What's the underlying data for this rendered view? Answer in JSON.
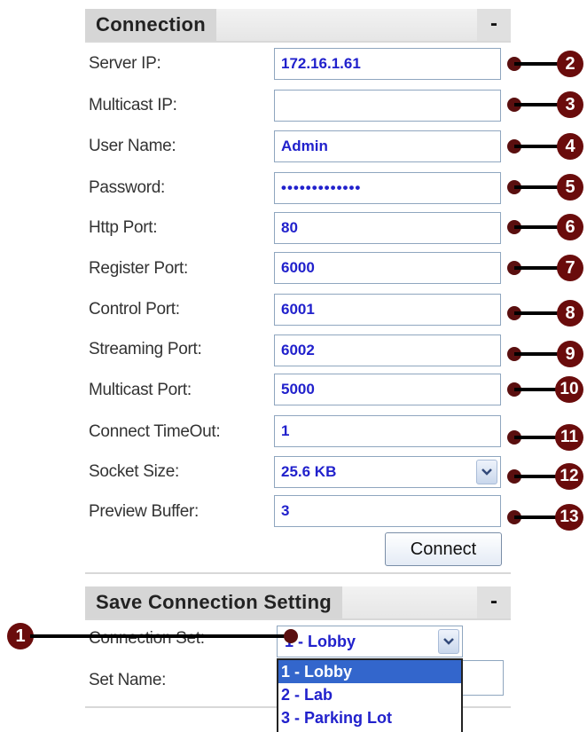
{
  "connection": {
    "header": "Connection",
    "collapse_label": "-",
    "fields": [
      {
        "label": "Server IP:",
        "value": "172.16.1.61",
        "callout": "2"
      },
      {
        "label": "Multicast IP:",
        "value": "",
        "callout": "3"
      },
      {
        "label": "User Name:",
        "value": "Admin",
        "callout": "4"
      },
      {
        "label": "Password:",
        "value": "•••••••••••••",
        "callout": "5"
      },
      {
        "label": "Http Port:",
        "value": "80",
        "callout": "6"
      },
      {
        "label": "Register Port:",
        "value": "6000",
        "callout": "7"
      },
      {
        "label": "Control Port:",
        "value": "6001",
        "callout": "8"
      },
      {
        "label": "Streaming Port:",
        "value": "6002",
        "callout": "9"
      },
      {
        "label": "Multicast Port:",
        "value": "5000",
        "callout": "10"
      },
      {
        "label": "Connect TimeOut:",
        "value": "1",
        "callout": "11"
      },
      {
        "label": "Socket Size:",
        "value": "25.6 KB",
        "callout": "12"
      },
      {
        "label": "Preview Buffer:",
        "value": "3",
        "callout": "13"
      }
    ],
    "connect_button": "Connect"
  },
  "save_setting": {
    "header": "Save Connection Setting",
    "collapse_label": "-",
    "connection_set_label": "Connection Set:",
    "connection_set_value": "1 - Lobby",
    "set_name_label": "Set Name:",
    "set_name_value": "",
    "callout": "1",
    "options": [
      "1 - Lobby",
      "2 - Lab",
      "3 - Parking Lot"
    ]
  },
  "colors": {
    "callout": "#6a0c0c",
    "value_text": "#2121cc",
    "selected_option": "#3366cc"
  }
}
